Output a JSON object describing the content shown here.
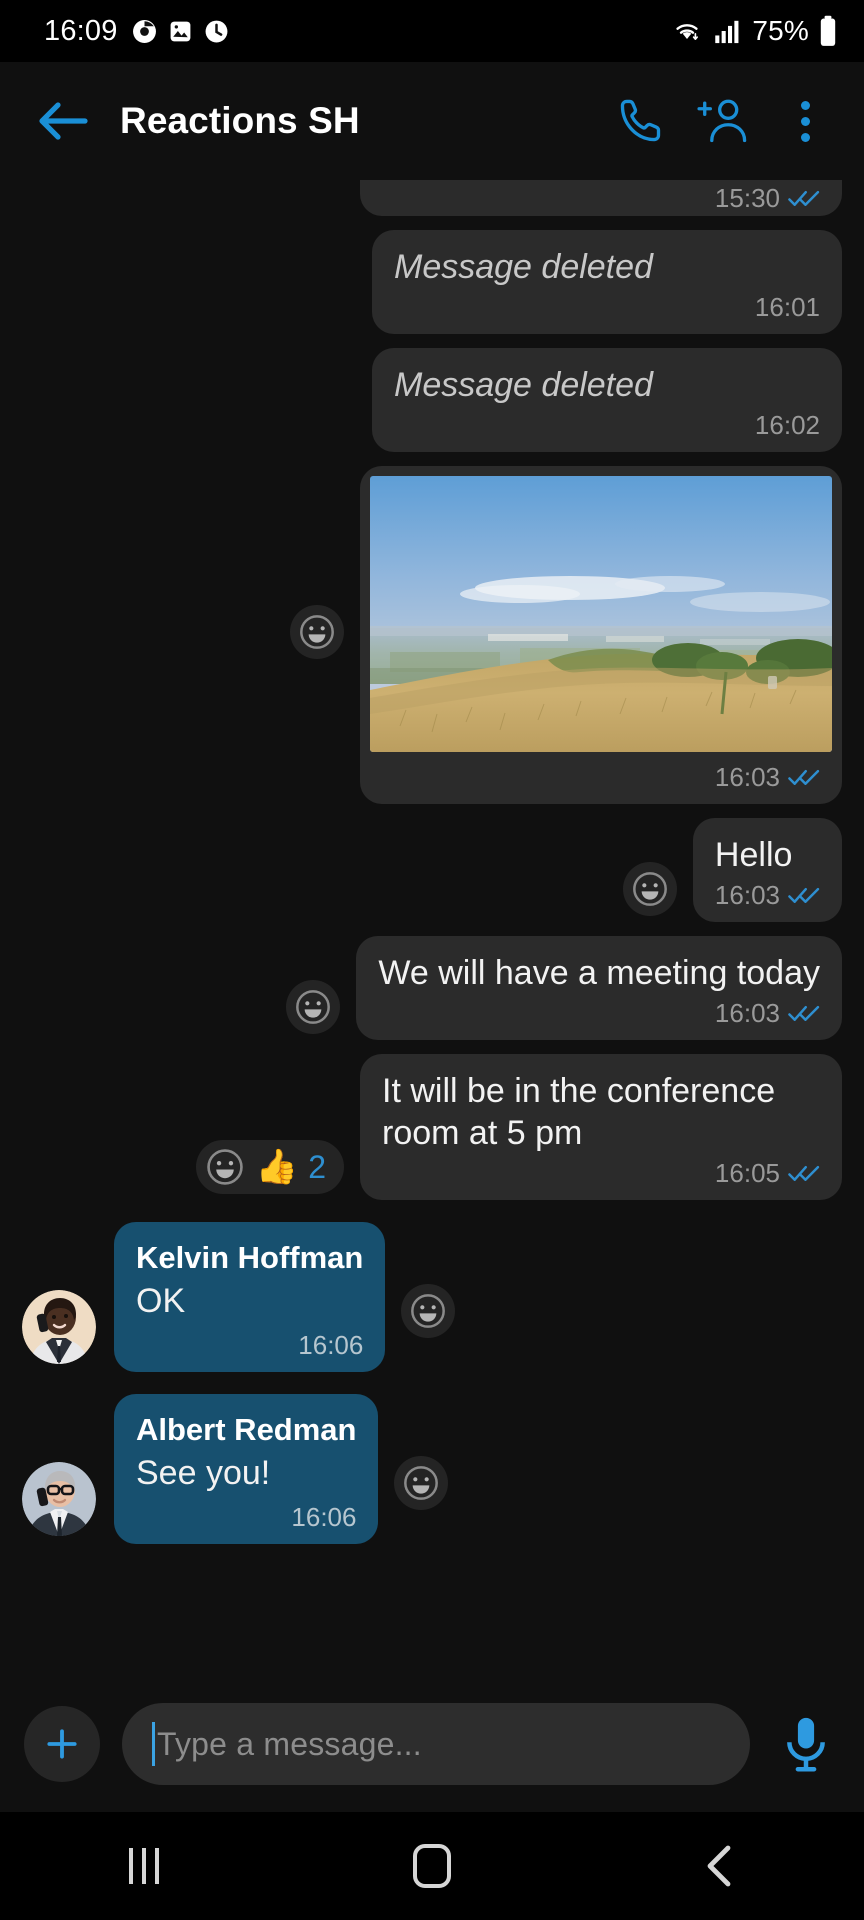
{
  "status_bar": {
    "clock": "16:09",
    "battery_percent": "75%",
    "icons": [
      "chrome-badge-icon",
      "gallery-icon",
      "clock-alarm-icon",
      "wifi-icon",
      "signal-icon",
      "battery-icon"
    ]
  },
  "app_bar": {
    "back_label": "back-arrow",
    "title": "Reactions SH",
    "actions": [
      "call-icon",
      "add-person-icon",
      "overflow-menu-icon"
    ],
    "accent_color": "#1a8fd6"
  },
  "messages": [
    {
      "id": "m0",
      "direction": "out",
      "kind": "text-partial",
      "text": "",
      "time": "15:30",
      "status": "read"
    },
    {
      "id": "m1",
      "direction": "out",
      "kind": "deleted",
      "text": "Message deleted",
      "time": "16:01",
      "status": "none"
    },
    {
      "id": "m2",
      "direction": "out",
      "kind": "deleted",
      "text": "Message deleted",
      "time": "16:02",
      "status": "none"
    },
    {
      "id": "m3",
      "direction": "out",
      "kind": "image",
      "alt": "Photo of a dry grassy hilltop overlooking a hazy green valley under a blue sky",
      "time": "16:03",
      "status": "read",
      "react_button": "add-reaction-icon"
    },
    {
      "id": "m4",
      "direction": "out",
      "kind": "text",
      "text": "Hello",
      "time": "16:03",
      "status": "read",
      "react_button": "add-reaction-icon"
    },
    {
      "id": "m5",
      "direction": "out",
      "kind": "text",
      "text": "We will have a meeting today",
      "time": "16:03",
      "status": "read",
      "react_button": "add-reaction-icon"
    },
    {
      "id": "m6",
      "direction": "out",
      "kind": "text",
      "text": "It will be in the conference room at 5 pm",
      "time": "16:05",
      "status": "read",
      "reaction": {
        "emoji": "👍",
        "count": "2",
        "count_color": "#2e8fd0"
      }
    },
    {
      "id": "m7",
      "direction": "in",
      "kind": "text",
      "sender": "Kelvin Hoffman",
      "text": "OK",
      "time": "16:06",
      "avatar": "avatar-kelvin-hoffman",
      "react_button": "add-reaction-icon"
    },
    {
      "id": "m8",
      "direction": "in",
      "kind": "text",
      "sender": "Albert Redman",
      "text": "See you!",
      "time": "16:06",
      "avatar": "avatar-albert-redman",
      "react_button": "add-reaction-icon"
    }
  ],
  "composer": {
    "attach_label": "+",
    "input_value": "",
    "placeholder": "Type a message...",
    "mic_label": "microphone"
  },
  "nav_bar": {
    "recents": "recents-button",
    "home": "home-button",
    "back": "back-button"
  },
  "colors": {
    "background": "#101010",
    "outgoing_bubble": "#2b2b2b",
    "incoming_bubble": "#17506f",
    "accent": "#1a8fd6",
    "tick_read": "#2e8fd0"
  }
}
